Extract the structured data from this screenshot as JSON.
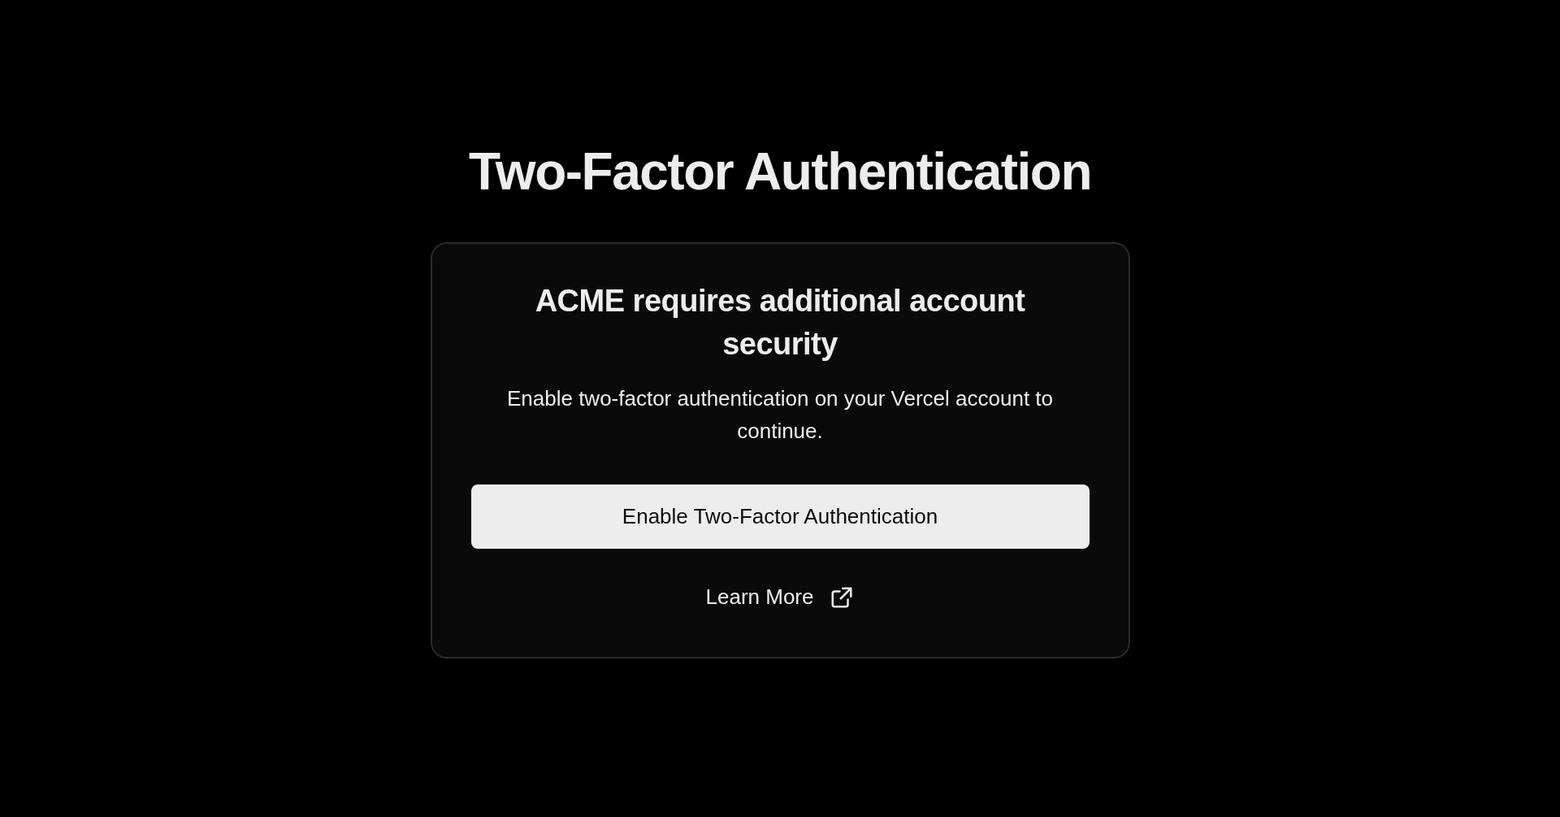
{
  "title": "Two-Factor Authentication",
  "card": {
    "heading": "ACME requires additional account security",
    "description": "Enable two-factor authentication on your Vercel account to continue.",
    "button": "Enable Two-Factor Authentication",
    "link": "Learn More"
  }
}
